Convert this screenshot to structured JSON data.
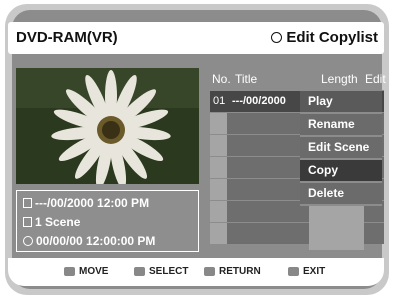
{
  "header": {
    "title": "DVD-RAM(VR)",
    "mode": "Edit Copylist"
  },
  "table": {
    "columns": [
      "No.",
      "Title",
      "Length",
      "Edit"
    ],
    "rows": [
      {
        "no": "01",
        "title": "---/00/2000"
      }
    ]
  },
  "menu": {
    "items": [
      "Play",
      "Rename",
      "Edit Scene",
      "Copy",
      "Delete"
    ],
    "active": "Copy"
  },
  "info": {
    "date": "---/00/2000 12:00 PM",
    "scenes": "1 Scene",
    "time": "00/00/00 12:00:00 PM"
  },
  "footer": {
    "move": "MOVE",
    "select": "SELECT",
    "return": "RETURN",
    "exit": "EXIT"
  }
}
